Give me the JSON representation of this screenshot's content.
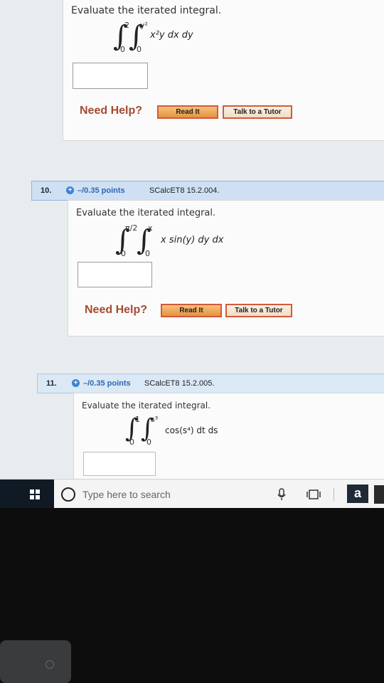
{
  "q9": {
    "prompt": "Evaluate the iterated integral.",
    "outer_upper": "2",
    "outer_lower": "0",
    "inner_upper": "y²",
    "inner_lower": "0",
    "integrand": "x²y dx dy"
  },
  "q10": {
    "number": "10.",
    "points": "–/0.35 points",
    "source": "SCalcET8 15.2.004.",
    "prompt": "Evaluate the iterated integral.",
    "outer_upper": "π/2",
    "outer_lower": "0",
    "inner_upper": "x",
    "inner_lower": "0",
    "integrand": "x sin(y) dy dx"
  },
  "q11": {
    "number": "11.",
    "points": "–/0.35 points",
    "source": "SCalcET8 15.2.005.",
    "prompt": "Evaluate the iterated integral.",
    "outer_upper": "1",
    "outer_lower": "0",
    "inner_upper": "s³",
    "inner_lower": "0",
    "integrand": "cos(s⁴) dt ds"
  },
  "help": {
    "need_help": "Need Help?",
    "read_it": "Read It",
    "talk_tutor": "Talk to a Tutor"
  },
  "taskbar": {
    "search_placeholder": "Type here to search"
  },
  "colors": {
    "accent_blue": "#2d67b4",
    "need_help_red": "#a54a33",
    "button_border": "#d25a3a"
  }
}
